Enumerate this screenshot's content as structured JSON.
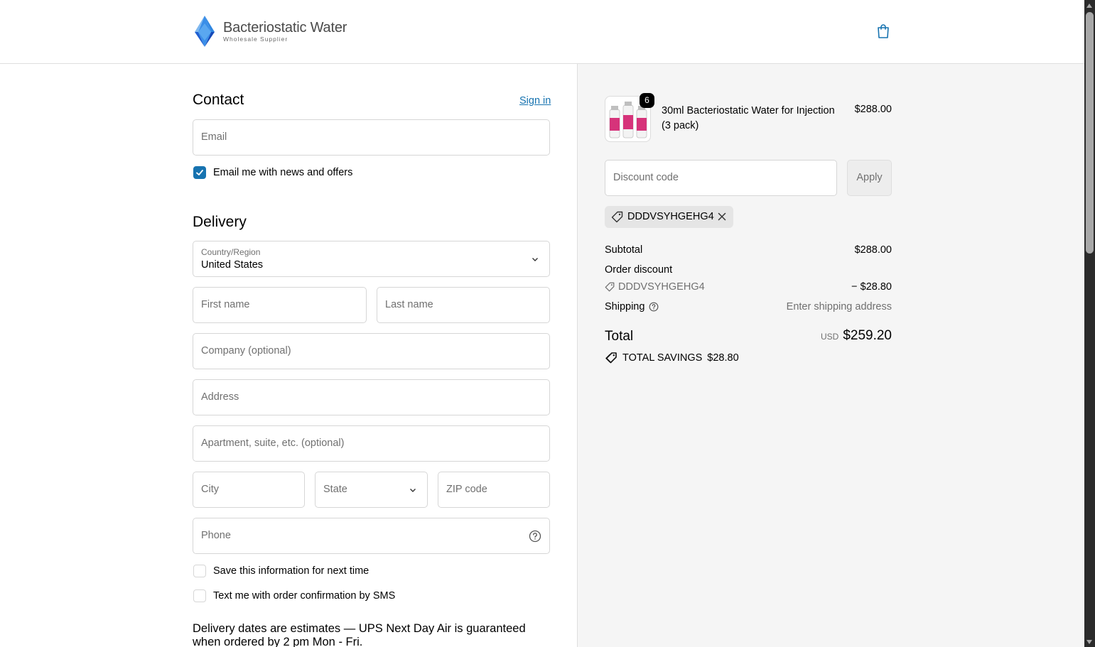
{
  "header": {
    "brand_title": "Bacteriostatic Water",
    "brand_subtitle": "Wholesale Supplier",
    "cart_icon": "shopping-bag-icon"
  },
  "contact": {
    "heading": "Contact",
    "sign_in": "Sign in",
    "email_placeholder": "Email",
    "newsletter_label": "Email me with news and offers",
    "newsletter_checked": true
  },
  "delivery": {
    "heading": "Delivery",
    "country_label": "Country/Region",
    "country_value": "United States",
    "first_name": "First name",
    "last_name": "Last name",
    "company": "Company (optional)",
    "address": "Address",
    "apartment": "Apartment, suite, etc. (optional)",
    "city": "City",
    "state": "State",
    "zip": "ZIP code",
    "phone": "Phone",
    "save_info_label": "Save this information for next time",
    "sms_label": "Text me with order confirmation by SMS",
    "note": "Delivery dates are estimates — UPS Next Day Air is guaranteed when ordered by 2 pm Mon - Fri."
  },
  "summary": {
    "product": {
      "name": "30ml Bacteriostatic Water for Injection (3 pack)",
      "price": "$288.00",
      "quantity": "6"
    },
    "discount_placeholder": "Discount code",
    "apply": "Apply",
    "applied_code": "DDDVSYHGEHG4",
    "subtotal_label": "Subtotal",
    "subtotal_value": "$288.00",
    "order_discount_label": "Order discount",
    "discount_code": "DDDVSYHGEHG4",
    "discount_value": "− $28.80",
    "shipping_label": "Shipping",
    "shipping_value": "Enter shipping address",
    "total_label": "Total",
    "total_currency": "USD",
    "total_value": "$259.20",
    "savings_label": "TOTAL SAVINGS",
    "savings_value": "$28.80"
  },
  "colors": {
    "accent": "#1773b0",
    "summary_bg": "#f5f5f5"
  }
}
